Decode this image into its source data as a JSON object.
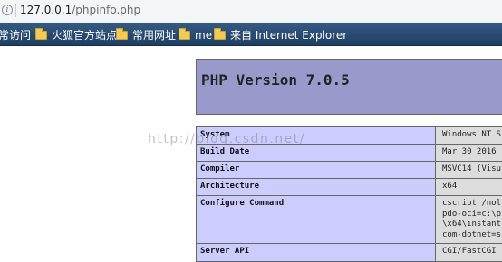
{
  "address_bar": {
    "url_host": "127.0.0.1",
    "url_path": "/phpinfo.php"
  },
  "bookmarks": [
    {
      "label": "常访问",
      "icon": ""
    },
    {
      "label": "火狐官方站点",
      "icon": "folder-icon"
    },
    {
      "label": "常用网址",
      "icon": "folder-icon"
    },
    {
      "label": "me",
      "icon": "folder-icon"
    },
    {
      "label": "来自 Internet Explorer",
      "icon": "folder-icon"
    }
  ],
  "phpinfo": {
    "title": "PHP Version 7.0.5",
    "rows": [
      {
        "key": "System",
        "value": "Windows NT S"
      },
      {
        "key": "Build Date",
        "value": "Mar 30 2016"
      },
      {
        "key": "Compiler",
        "value": "MSVC14 (Visu"
      },
      {
        "key": "Architecture",
        "value": "x64"
      },
      {
        "key": "Configure Command",
        "value": "cscript /nol\npdo-oci=c:\\p\n\\x64\\instant\ncom-dotnet=s"
      },
      {
        "key": "Server API",
        "value": "CGI/FastCGI"
      }
    ]
  },
  "watermark": "http://blog.csdn.net/",
  "colors": {
    "header_bg": "#9999cc",
    "key_bg": "#ccccff",
    "value_bg": "#dcdcdc",
    "bookmark_bar": "#2c4d75"
  }
}
